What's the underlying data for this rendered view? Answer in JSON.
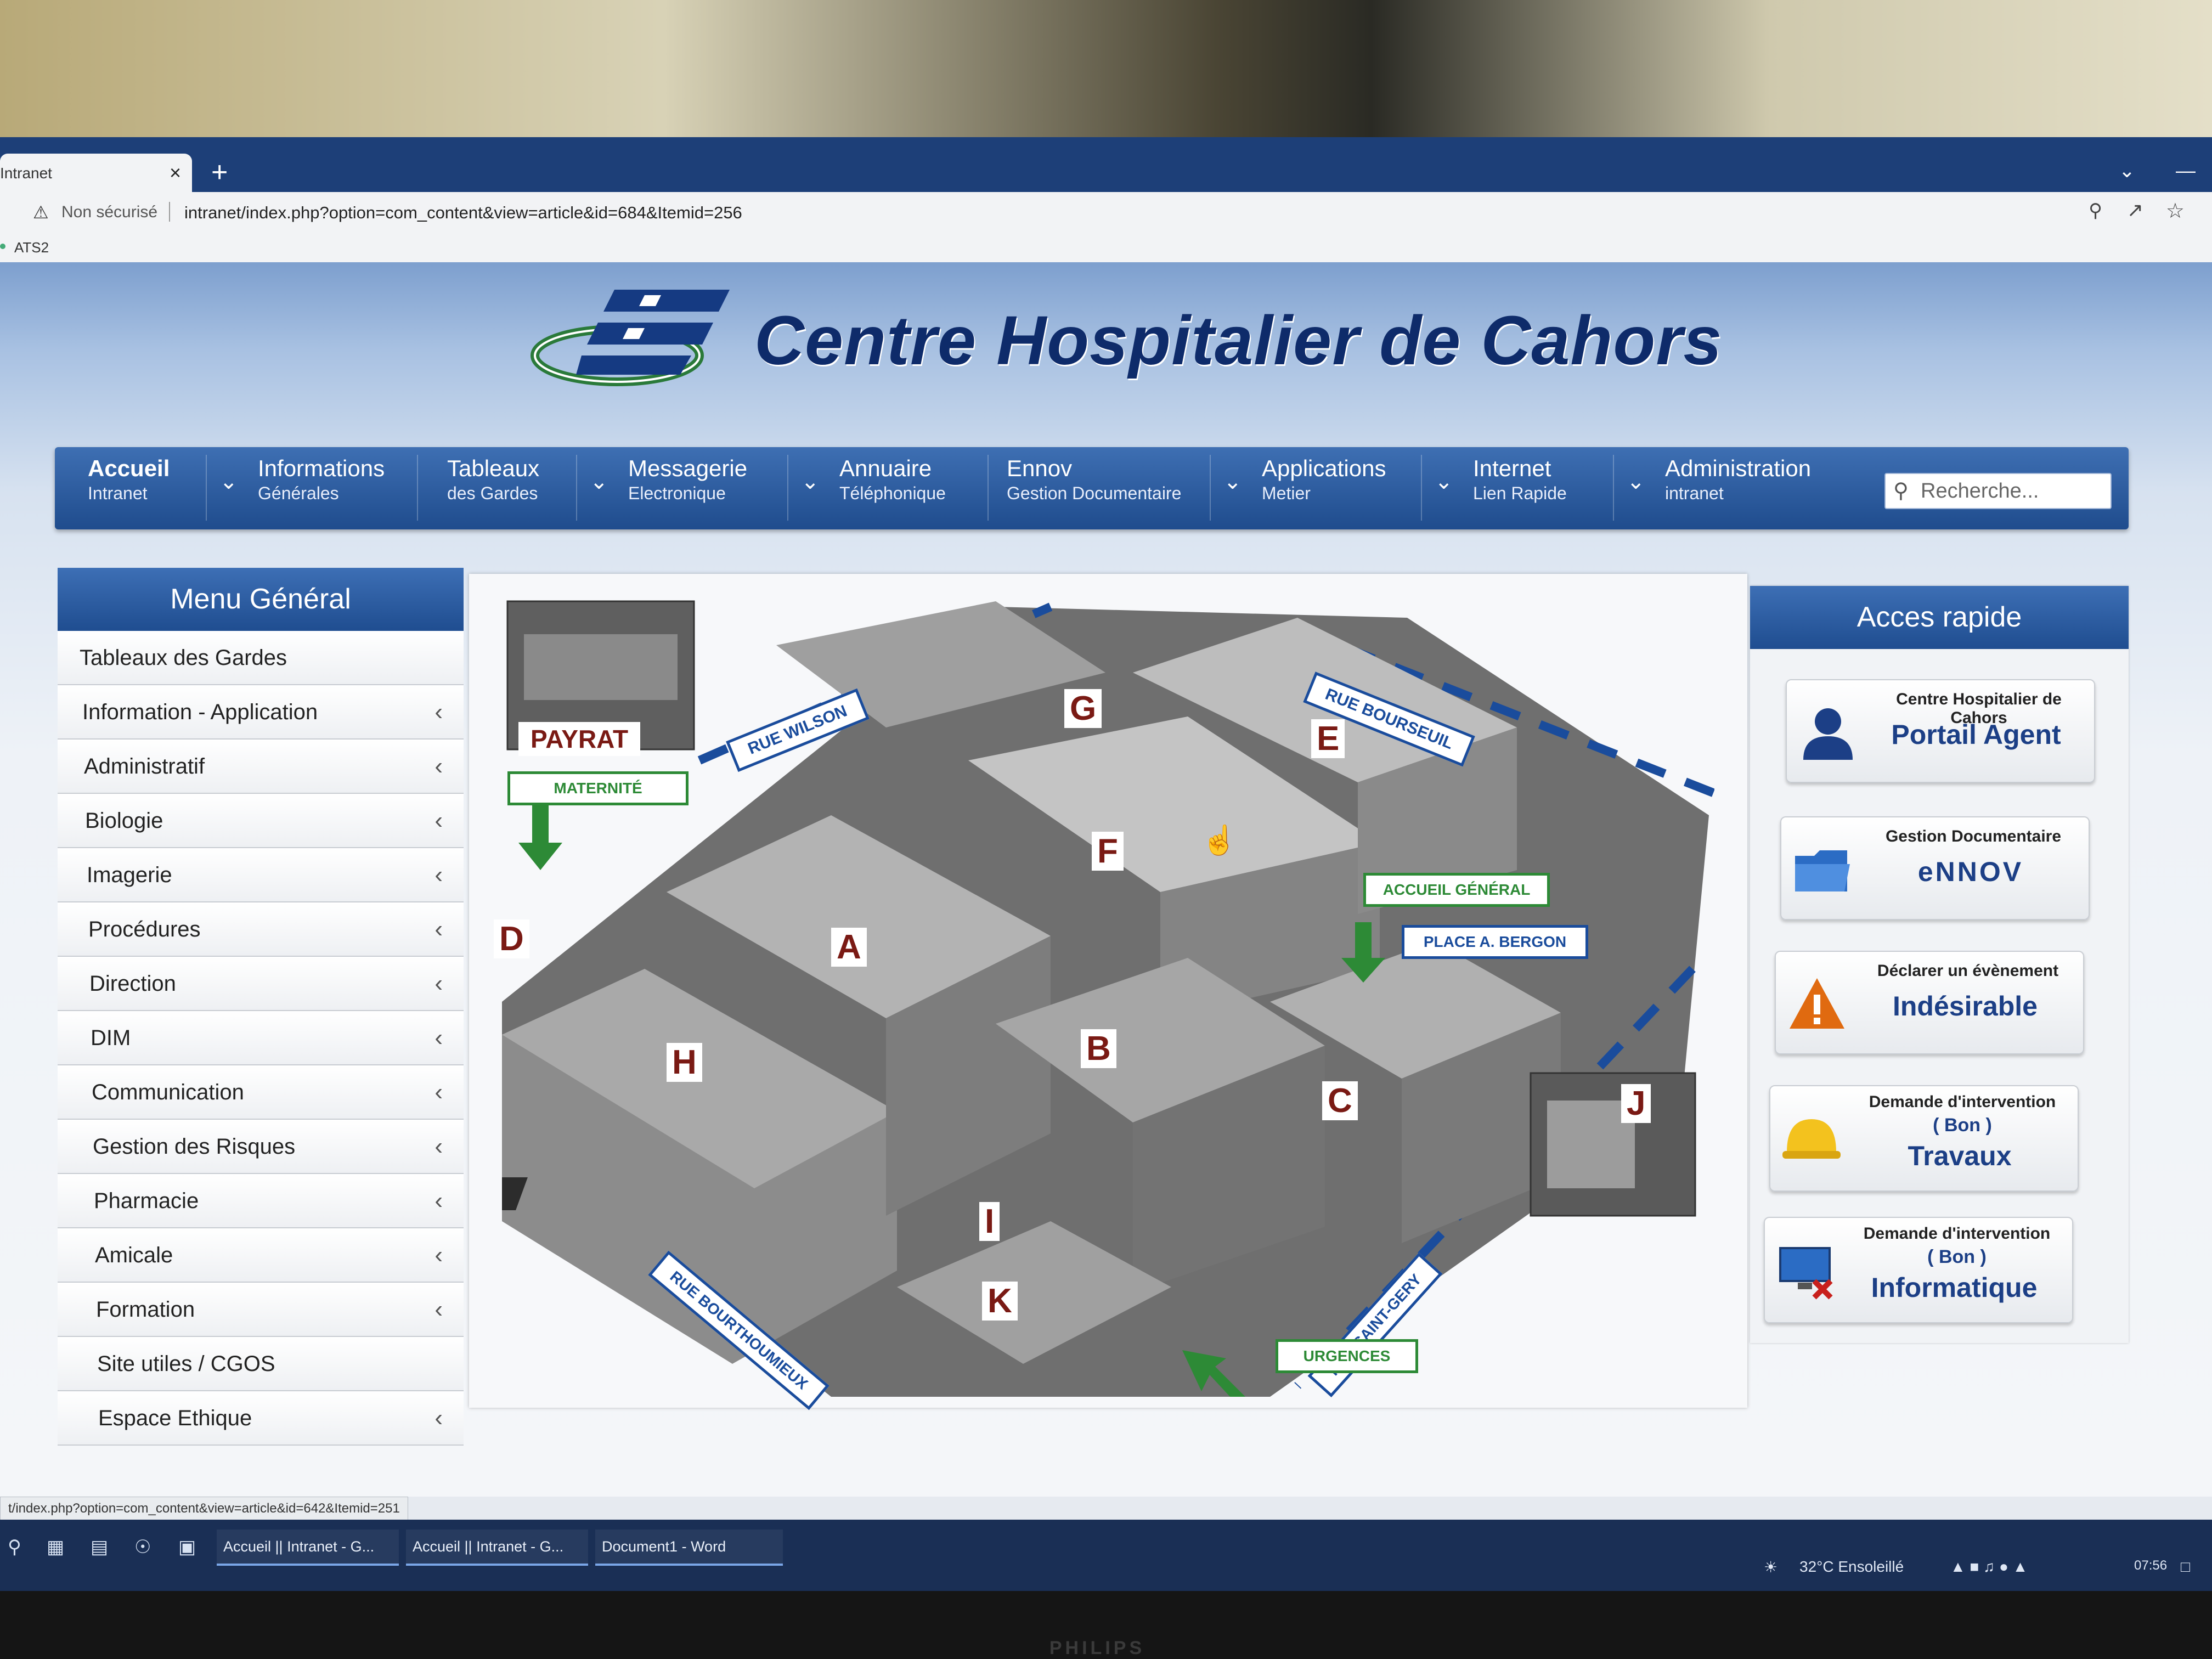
{
  "browser": {
    "tab_title": "Intranet",
    "tab_close": "×",
    "new_tab": "+",
    "security_label": "Non sécurisé",
    "url": "intranet/index.php?option=com_content&view=article&id=684&Itemid=256",
    "bookmark": "ATS2",
    "tab_menu_icon": "chevron-down-icon",
    "minimize_icon": "minimize-icon"
  },
  "site": {
    "title": "Centre Hospitalier de Cahors",
    "logo_icon": "ch-cahors-logo"
  },
  "nav": {
    "items": [
      {
        "main": "Accueil",
        "sub": "Intranet",
        "dropdown": false,
        "active": true
      },
      {
        "main": "Informations",
        "sub": "Générales",
        "dropdown": true
      },
      {
        "main": "Tableaux",
        "sub": "des Gardes",
        "dropdown": false
      },
      {
        "main": "Messagerie",
        "sub": "Electronique",
        "dropdown": true
      },
      {
        "main": "Annuaire",
        "sub": "Téléphonique",
        "dropdown": true
      },
      {
        "main": "Ennov",
        "sub": "Gestion Documentaire",
        "dropdown": false
      },
      {
        "main": "Applications",
        "sub": "Metier",
        "dropdown": true
      },
      {
        "main": "Internet",
        "sub": "Lien Rapide",
        "dropdown": true
      },
      {
        "main": "Administration",
        "sub": "intranet",
        "dropdown": true
      }
    ],
    "search_placeholder": "Recherche..."
  },
  "menu": {
    "title": "Menu Général",
    "items": [
      {
        "label": "Tableaux des Gardes",
        "chevron": false
      },
      {
        "label": "Information - Application",
        "chevron": true
      },
      {
        "label": "Administratif",
        "chevron": true
      },
      {
        "label": "Biologie",
        "chevron": true
      },
      {
        "label": "Imagerie",
        "chevron": true
      },
      {
        "label": "Procédures",
        "chevron": true
      },
      {
        "label": "Direction",
        "chevron": true
      },
      {
        "label": "DIM",
        "chevron": true
      },
      {
        "label": "Communication",
        "chevron": true
      },
      {
        "label": "Gestion des Risques",
        "chevron": true
      },
      {
        "label": "Pharmacie",
        "chevron": true
      },
      {
        "label": "Amicale",
        "chevron": true
      },
      {
        "label": "Formation",
        "chevron": true
      },
      {
        "label": "Site utiles / CGOS",
        "chevron": false
      },
      {
        "label": "Espace Ethique",
        "chevron": true
      }
    ],
    "chevron_glyph": "‹"
  },
  "map": {
    "streets": [
      "RUE WILSON",
      "RUE BOURSEUIL",
      "RUE BOURTHOUMIEUX",
      "RUE SAINT-GERY"
    ],
    "places": [
      "PAYRAT",
      "MATERNITÉ",
      "ACCUEIL GÉNÉRAL",
      "PLACE A. BERGON",
      "URGENCES"
    ],
    "buildings": [
      "A",
      "B",
      "C",
      "D",
      "E",
      "F",
      "G",
      "H",
      "I",
      "J",
      "K"
    ],
    "colors": {
      "street_dash": "#1a4c9c",
      "green_label": "#2d8a36",
      "letter": "#7a1a14"
    }
  },
  "quick": {
    "title": "Acces rapide",
    "cards": [
      {
        "top": "Centre Hospitalier de Cahors",
        "main": "Portail Agent",
        "icon": "user-icon"
      },
      {
        "top": "Gestion Documentaire",
        "main": "eNNOV",
        "icon": "folder-icon"
      },
      {
        "top": "Déclarer un évènement",
        "main": "Indésirable",
        "icon": "warning-icon"
      },
      {
        "top": "Demande d'intervention",
        "mid": "( Bon )",
        "main": "Travaux",
        "icon": "hard-hat-icon"
      },
      {
        "top": "Demande d'intervention",
        "mid": "( Bon )",
        "main": "Informatique",
        "icon": "computer-icon"
      }
    ]
  },
  "status_url": "t/index.php?option=com_content&view=article&id=642&Itemid=251",
  "taskbar": {
    "tasks": [
      "Accueil || Intranet - G...",
      "Accueil || Intranet - G...",
      "Document1 - Word"
    ],
    "weather": "32°C  Ensoleillé",
    "time": "07:56"
  },
  "monitor_brand": "PHILIPS"
}
